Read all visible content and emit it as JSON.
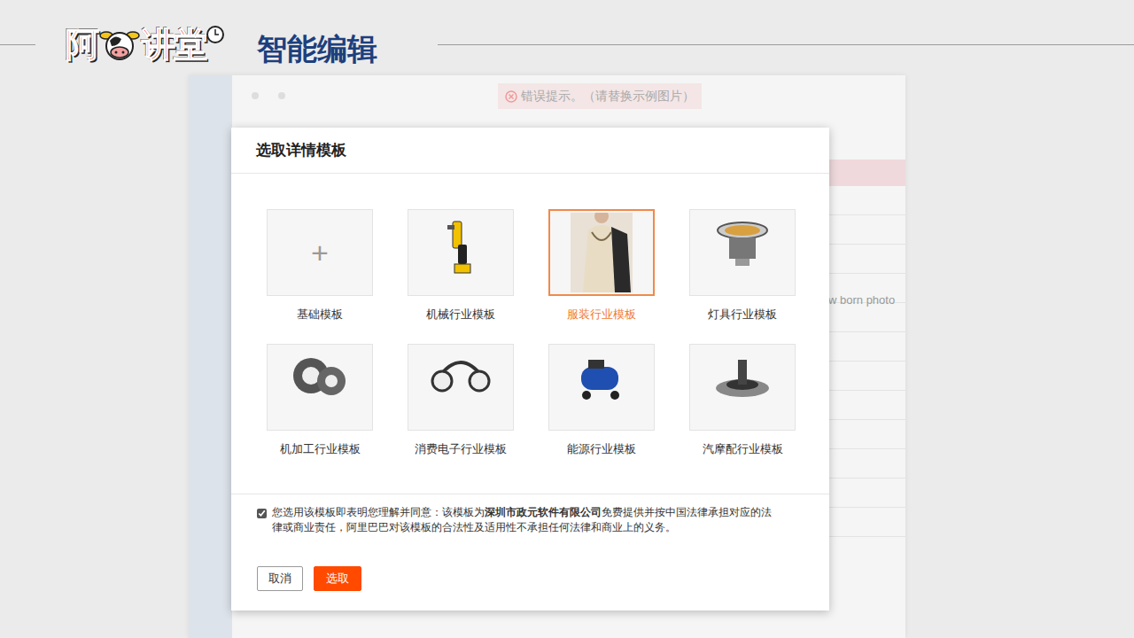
{
  "header": {
    "logo": {
      "parts": [
        "阿",
        "讲堂"
      ]
    },
    "title": "智能编辑"
  },
  "background_page": {
    "error_tip": "错误提示。（请替换示例图片）",
    "side_text": "w born photo"
  },
  "dialog": {
    "title": "选取详情模板",
    "templates": [
      {
        "label": "基础模板",
        "selected": false,
        "kind": "blank",
        "glyph": "+"
      },
      {
        "label": "机械行业模板",
        "selected": false,
        "kind": "photo"
      },
      {
        "label": "服装行业模板",
        "selected": true,
        "kind": "photo"
      },
      {
        "label": "灯具行业模板",
        "selected": false,
        "kind": "photo"
      },
      {
        "label": "机加工行业模板",
        "selected": false,
        "kind": "photo"
      },
      {
        "label": "消费电子行业模板",
        "selected": false,
        "kind": "photo"
      },
      {
        "label": "能源行业模板",
        "selected": false,
        "kind": "photo"
      },
      {
        "label": "汽摩配行业模板",
        "selected": false,
        "kind": "photo"
      }
    ],
    "agreement": {
      "checked": true,
      "text_before": "您选用该模板即表明您理解并同意：该模板为",
      "company": "深圳市政元软件有限公司",
      "text_after": "免费提供并按中国法律承担对应的法律或商业责任，阿里巴巴对该模板的合法性及适用性不承担任何法律和商业上的义务。"
    },
    "buttons": [
      {
        "label": "取消",
        "kind": "secondary"
      },
      {
        "label": "选取",
        "kind": "primary"
      }
    ]
  }
}
